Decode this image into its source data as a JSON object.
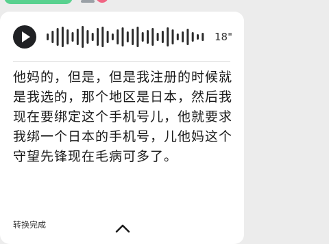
{
  "voice_message": {
    "duration": "18\"",
    "transcript": "他妈的，但是，但是我注册的时候就是我选的，那个地区是日本，然后我现在要绑定这个手机号儿，他就要求我绑一个日本的手机号，儿他妈这个守望先锋现在毛病可多了。",
    "status": "转换完成",
    "icons": {
      "play": "play-icon",
      "collapse": "chevron-up-icon"
    }
  },
  "colors": {
    "background": "#ececec",
    "bubble": "#ffffff",
    "play_button": "#202124",
    "waveform": "#2b2b2b",
    "accent_green": "#59d18f"
  }
}
